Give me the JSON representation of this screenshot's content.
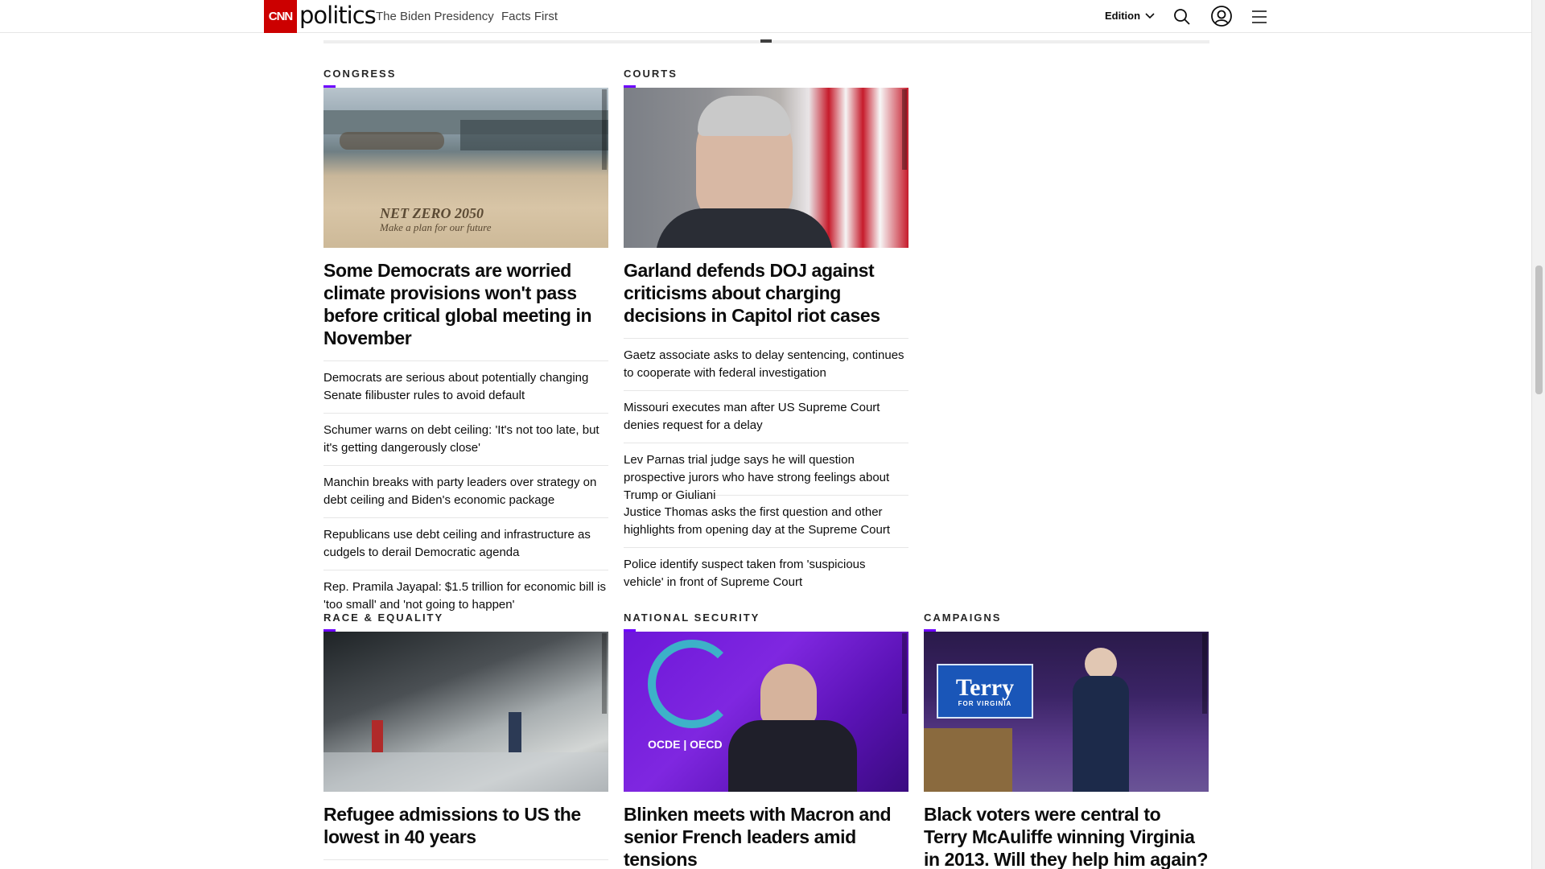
{
  "header": {
    "logo_text": "CNN",
    "section_title": "politics",
    "nav": [
      "The Biden Presidency",
      "Facts First"
    ],
    "edition_label": "Edition",
    "icons": [
      "search-icon",
      "account-icon",
      "menu-icon",
      "chevron-down-icon"
    ]
  },
  "colors": {
    "brand_red": "#cc0000",
    "section_accent": "#6e00ff"
  },
  "sections": {
    "congress": {
      "label": "CONGRESS",
      "headline": "Some Democrats are worried climate provisions won't pass before critical global meeting in November",
      "image_caption": "NET ZERO 2050",
      "image_subcaption": "Make a plan for our future",
      "stories": [
        "Democrats are serious about potentially changing Senate filibuster rules to avoid default",
        "Schumer warns on debt ceiling: 'It's not too late, but it's getting dangerously close'",
        "Manchin breaks with party leaders over strategy on debt ceiling and Biden's economic package",
        "Republicans use debt ceiling and infrastructure as cudgels to derail Democratic agenda",
        "Rep. Pramila Jayapal: $1.5 trillion for economic bill is 'too small' and 'not going to happen'"
      ]
    },
    "courts": {
      "label": "COURTS",
      "headline": "Garland defends DOJ against criticisms about charging decisions in Capitol riot cases",
      "stories": [
        "Gaetz associate asks to delay sentencing, continues to cooperate with federal investigation",
        "Missouri executes man after US Supreme Court denies request for a delay",
        "Lev Parnas trial judge says he will question prospective jurors who have strong feelings about Trump or Giuliani",
        "Justice Thomas asks the first question and other highlights from opening day at the Supreme Court",
        "Police identify suspect taken from 'suspicious vehicle' in front of Supreme Court"
      ]
    },
    "race": {
      "label": "RACE & EQUALITY",
      "headline": "Refugee admissions to US the lowest in 40 years"
    },
    "natsec": {
      "label": "NATIONAL SECURITY",
      "headline": "Blinken meets with Macron and senior French leaders amid tensions",
      "image_caption": "OCDE | OECD"
    },
    "campaigns": {
      "label": "CAMPAIGNS",
      "headline": "Black voters were central to Terry McAuliffe winning Virginia in 2013. Will they help him again?",
      "image_caption": "Terry",
      "image_subcaption": "FOR VIRGINIA"
    }
  }
}
